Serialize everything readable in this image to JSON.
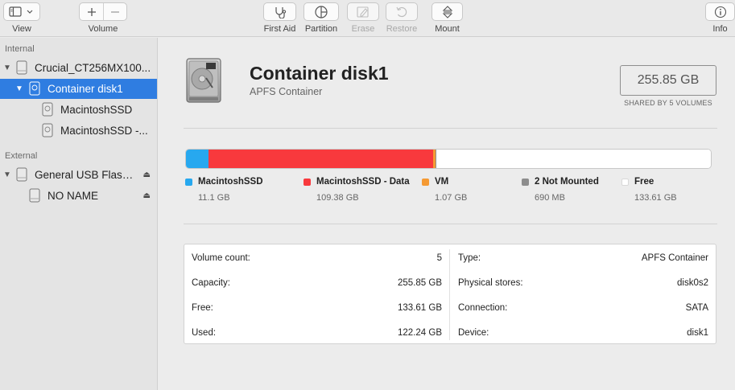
{
  "toolbar": {
    "view_label": "View",
    "volume_label": "Volume",
    "first_aid_label": "First Aid",
    "partition_label": "Partition",
    "erase_label": "Erase",
    "restore_label": "Restore",
    "mount_label": "Mount",
    "info_label": "Info"
  },
  "sidebar": {
    "internal_heading": "Internal",
    "external_heading": "External",
    "items": [
      {
        "label": "Crucial_CT256MX100..."
      },
      {
        "label": "Container disk1"
      },
      {
        "label": "MacintoshSSD"
      },
      {
        "label": "MacintoshSSD -..."
      },
      {
        "label": "General USB Flash..."
      },
      {
        "label": "NO NAME"
      }
    ]
  },
  "disk": {
    "title": "Container disk1",
    "subtitle": "APFS Container",
    "size": "255.85 GB",
    "shared_caption": "SHARED BY 5 VOLUMES"
  },
  "usage": {
    "segments": [
      {
        "name": "MacintoshSSD",
        "size": "11.1 GB",
        "gb": 11.1,
        "color": "#27a8ef"
      },
      {
        "name": "MacintoshSSD - Data",
        "size": "109.38 GB",
        "gb": 109.38,
        "color": "#f8393d"
      },
      {
        "name": "VM",
        "size": "1.07 GB",
        "gb": 1.07,
        "color": "#f59a33"
      },
      {
        "name": "2 Not Mounted",
        "size": "690 MB",
        "gb": 0.69,
        "color": "#8d8d8d"
      },
      {
        "name": "Free",
        "size": "133.61 GB",
        "gb": 133.61,
        "color": "#ffffff"
      }
    ]
  },
  "info": {
    "left": [
      {
        "key": "Volume count:",
        "value": "5"
      },
      {
        "key": "Capacity:",
        "value": "255.85 GB"
      },
      {
        "key": "Free:",
        "value": "133.61 GB"
      },
      {
        "key": "Used:",
        "value": "122.24 GB"
      }
    ],
    "right": [
      {
        "key": "Type:",
        "value": "APFS Container"
      },
      {
        "key": "Physical stores:",
        "value": "disk0s2"
      },
      {
        "key": "Connection:",
        "value": "SATA"
      },
      {
        "key": "Device:",
        "value": "disk1"
      }
    ]
  }
}
